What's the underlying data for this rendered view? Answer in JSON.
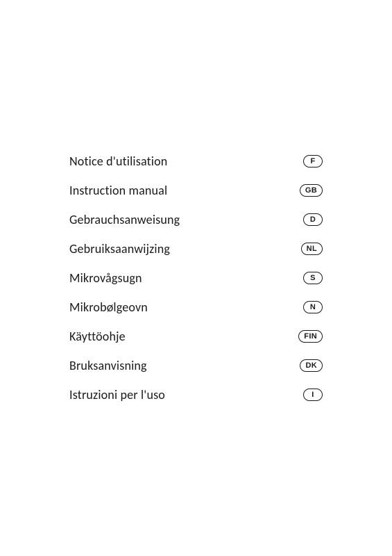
{
  "menu": {
    "items": [
      {
        "label": "Notice d'utilisation",
        "badge": "F"
      },
      {
        "label": "Instruction manual",
        "badge": "GB"
      },
      {
        "label": "Gebrauchsanweisung",
        "badge": "D"
      },
      {
        "label": "Gebruiksaanwijzing",
        "badge": "NL"
      },
      {
        "label": "Mikrovågsugn",
        "badge": "S"
      },
      {
        "label": "Mikrobølgeovn",
        "badge": "N"
      },
      {
        "label": "Käyttöohje",
        "badge": "FIN"
      },
      {
        "label": "Bruksanvisning",
        "badge": "DK"
      },
      {
        "label": "Istruzioni per l'uso",
        "badge": "I"
      }
    ]
  }
}
